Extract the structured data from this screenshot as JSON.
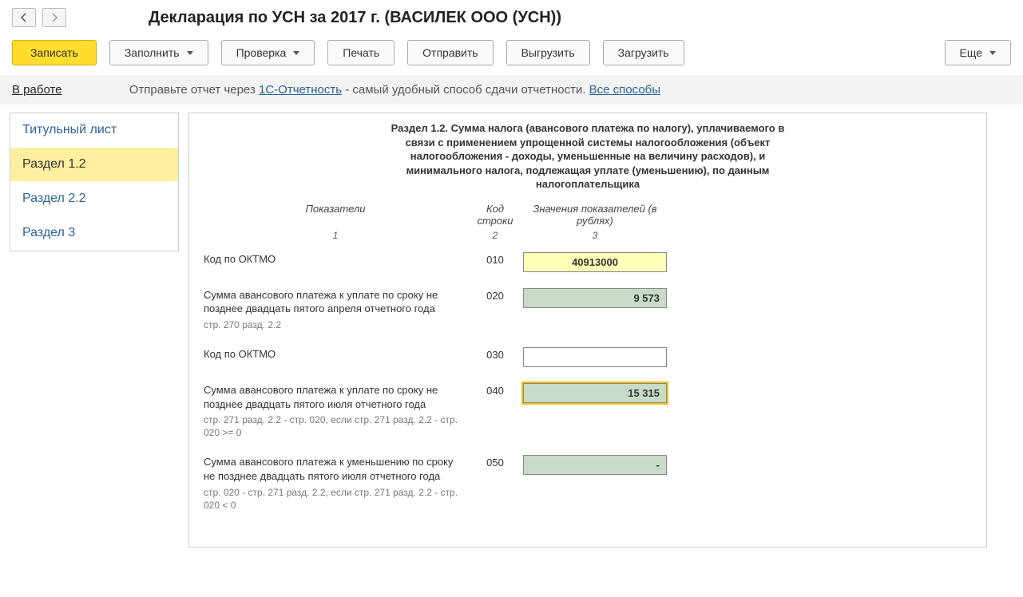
{
  "nav": {
    "back": "←",
    "forward": "→"
  },
  "page_title": "Декларация по УСН за 2017 г. (ВАСИЛЕК ООО (УСН))",
  "toolbar": {
    "save": "Записать",
    "fill": "Заполнить",
    "check": "Проверка",
    "print": "Печать",
    "send": "Отправить",
    "export": "Выгрузить",
    "import": "Загрузить",
    "more": "Еще"
  },
  "status": {
    "in_work": "В работе",
    "text_before": "Отправьте отчет через ",
    "link1": "1С-Отчетность",
    "text_after": " - самый удобный способ сдачи отчетности. ",
    "link2": "Все способы"
  },
  "sidebar": {
    "items": [
      {
        "label": "Титульный лист"
      },
      {
        "label": "Раздел 1.2"
      },
      {
        "label": "Раздел 2.2"
      },
      {
        "label": "Раздел 3"
      }
    ],
    "active_index": 1
  },
  "section": {
    "title": "Раздел 1.2. Сумма налога (авансового платежа по налогу), уплачиваемого в связи с применением упрощенной системы налогообложения (объект налогообложения - доходы, уменьшенные на величину расходов), и минимального налога, подлежащая уплате (уменьшению), по данным налогоплательщика",
    "headers": {
      "col1": "Показатели",
      "col2": "Код строки",
      "col3": "Значения показателей (в рублях)"
    },
    "nums": {
      "c1": "1",
      "c2": "2",
      "c3": "3"
    }
  },
  "rows": [
    {
      "label": "Код по ОКТМО",
      "note": "",
      "code": "010",
      "value": "40913000",
      "style": "yellow"
    },
    {
      "label": "Сумма авансового платежа к уплате по сроку не позднее двадцать пятого апреля отчетного года",
      "note": "стр. 270 разд. 2.2",
      "code": "020",
      "value": "9 573",
      "style": "green"
    },
    {
      "label": "Код по ОКТМО",
      "note": "",
      "code": "030",
      "value": "",
      "style": "white"
    },
    {
      "label": "Сумма  авансового платежа к уплате по сроку не позднее двадцать пятого июля отчетного года",
      "note": "стр. 271 разд. 2.2 - стр. 020,\nесли стр. 271 разд. 2.2 - стр. 020 >= 0",
      "code": "040",
      "value": "15 315",
      "style": "green selected"
    },
    {
      "label": "Сумма авансового платежа к уменьшению по сроку не позднее двадцать пятого июля отчетного года",
      "note": "стр. 020 - стр. 271 разд. 2.2,\nесли стр. 271 разд. 2.2 - стр. 020 < 0",
      "code": "050",
      "value": "-",
      "style": "green"
    }
  ]
}
